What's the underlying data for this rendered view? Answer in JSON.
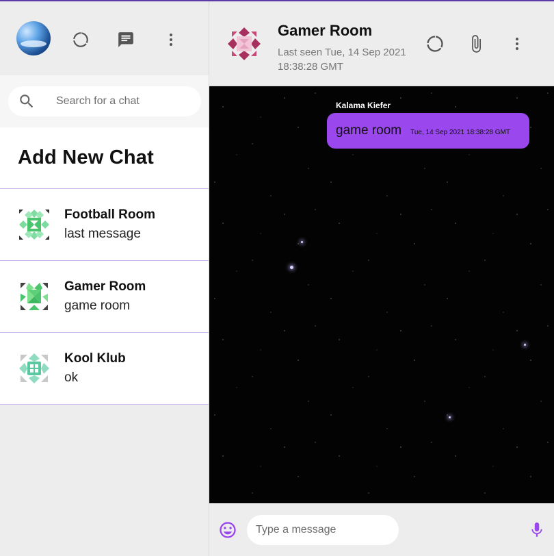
{
  "sidebar": {
    "search_placeholder": "Search for a chat",
    "add_new_chat": "Add New Chat",
    "chats": [
      {
        "name": "Football Room",
        "last_message": "last message"
      },
      {
        "name": "Gamer Room",
        "last_message": "game room"
      },
      {
        "name": "Kool Klub",
        "last_message": "ok"
      }
    ]
  },
  "chat": {
    "title": "Gamer Room",
    "last_seen": "Last seen Tue, 14 Sep 2021 18:38:28 GMT",
    "messages": [
      {
        "sender": "Kalama Kiefer",
        "text": "game room",
        "timestamp": "Tue, 14 Sep 2021 18:38:28 GMT"
      }
    ],
    "input_placeholder": "Type a message"
  },
  "icons": {
    "sidebar_header": [
      "avatar",
      "status-icon",
      "chat-icon",
      "more-vert-icon"
    ],
    "chat_header": [
      "status-icon",
      "attach-icon",
      "more-vert-icon"
    ],
    "footer": [
      "emoji-icon",
      "mic-icon"
    ],
    "search": "search-icon"
  },
  "colors": {
    "accent": "#9a47ee",
    "divider": "#c9b7e8",
    "background": "#ededed"
  }
}
